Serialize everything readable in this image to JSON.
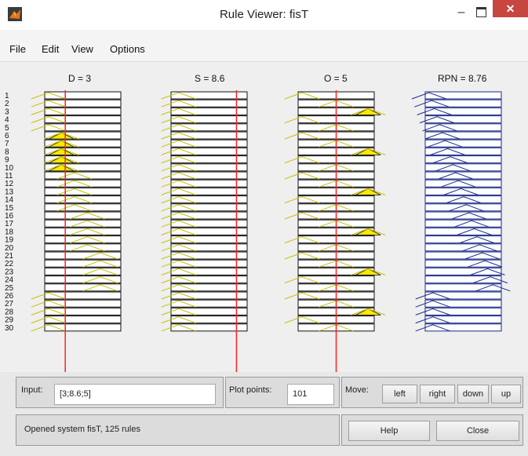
{
  "window": {
    "title": "Rule Viewer: fisT"
  },
  "menu": [
    "File",
    "Edit",
    "View",
    "Options"
  ],
  "variables": [
    {
      "label": "D = 3",
      "value": 3,
      "kind": "input"
    },
    {
      "label": "S = 8.6",
      "value": 8.6,
      "kind": "input"
    },
    {
      "label": "O = 5",
      "value": 5,
      "kind": "input"
    },
    {
      "label": "RPN = 8.76",
      "value": 8.76,
      "kind": "output"
    }
  ],
  "rules": {
    "visible_numbers": [
      "1",
      "2",
      "3",
      "4",
      "5",
      "6",
      "7",
      "8",
      "9",
      "10",
      "11",
      "12",
      "13",
      "14",
      "15",
      "16",
      "17",
      "18",
      "19",
      "20",
      "21",
      "22",
      "23",
      "24",
      "25",
      "26",
      "27",
      "28",
      "29",
      "30"
    ],
    "total": 125
  },
  "input": {
    "label": "Input:",
    "value": "[3;8.6;5]"
  },
  "plot_points": {
    "label": "Plot points:",
    "value": "101"
  },
  "move": {
    "label": "Move:",
    "buttons": [
      "left",
      "right",
      "down",
      "up"
    ]
  },
  "status": "Opened system fisT, 125 rules",
  "help_label": "Help",
  "close_label": "Close",
  "colors": {
    "indicator": "#ff2020",
    "fill": "#ffe800",
    "output_line": "#1a2a8a",
    "mf_line": "#c6c200"
  }
}
